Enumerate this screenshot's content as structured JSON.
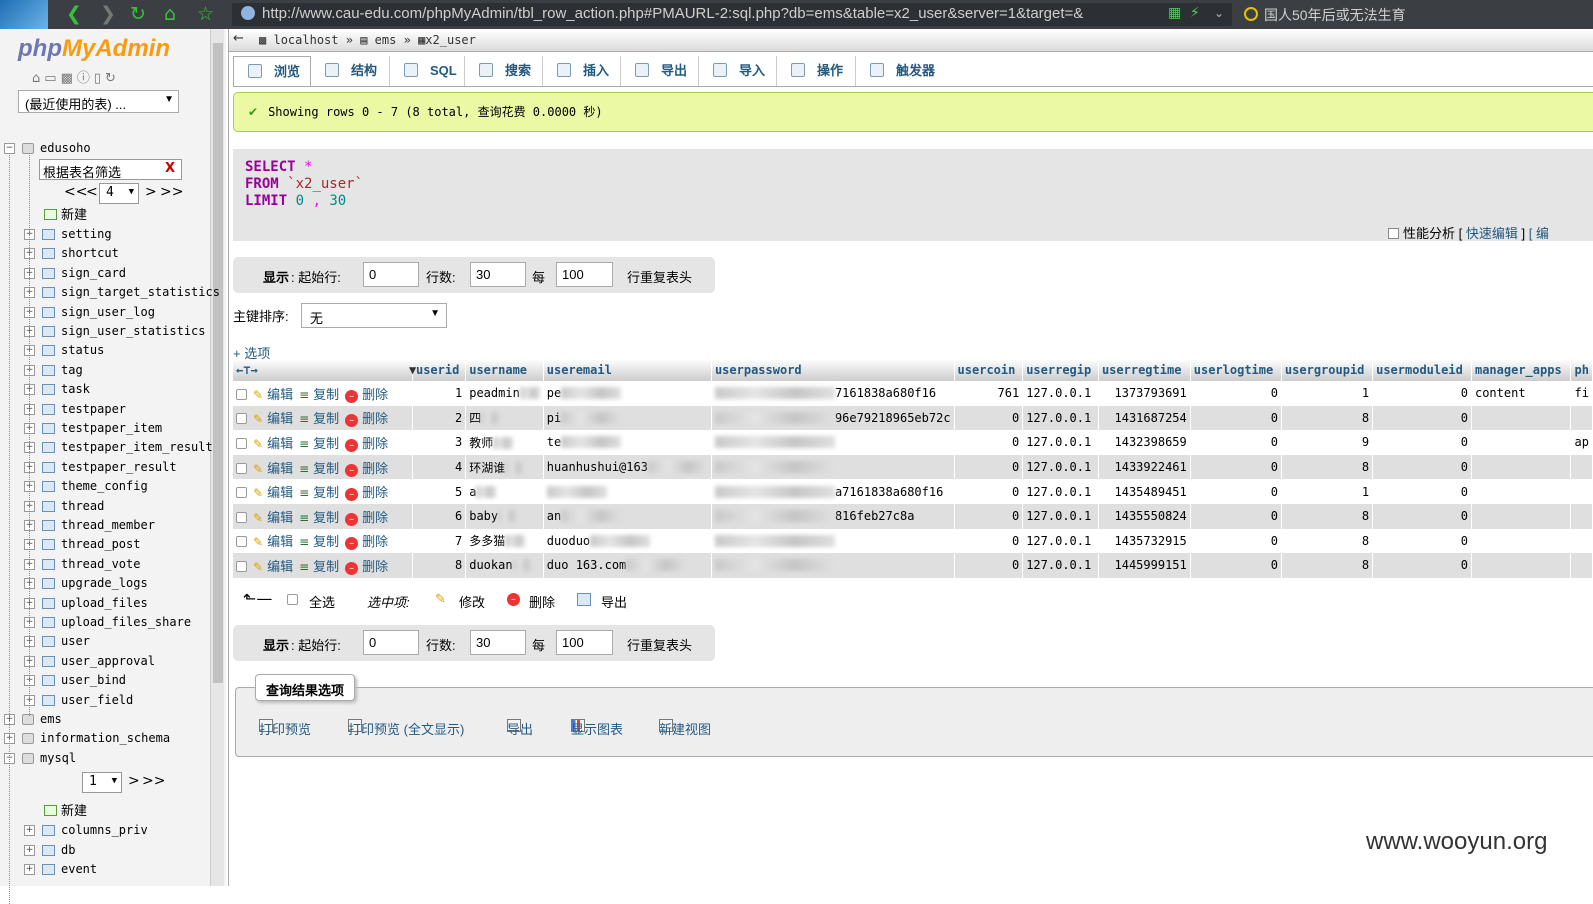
{
  "browser": {
    "url": "http://www.cau-edu.com/phpMyAdmin/tbl_row_action.php#PMAURL-2:sql.php?db=ems&table=x2_user&server=1&target=&",
    "news": "国人50年后或无法生育",
    "icons": [
      "back-icon",
      "forward-icon",
      "refresh-icon",
      "home-icon",
      "star-icon"
    ]
  },
  "sidebar": {
    "logo_php": "php",
    "logo_rest": "MyAdmin",
    "recent": "(最近使用的表) ...",
    "db_edusoho": "edusoho",
    "filter_placeholder": "根据表名筛选",
    "filter_clear": "X",
    "pager1": {
      "first": "<<",
      "prev": "<",
      "value": "4",
      "next": ">",
      "last": ">>"
    },
    "new_label": "新建",
    "tables": [
      "setting",
      "shortcut",
      "sign_card",
      "sign_target_statistics",
      "sign_user_log",
      "sign_user_statistics",
      "status",
      "tag",
      "task",
      "testpaper",
      "testpaper_item",
      "testpaper_item_result",
      "testpaper_result",
      "theme_config",
      "thread",
      "thread_member",
      "thread_post",
      "thread_vote",
      "upgrade_logs",
      "upload_files",
      "upload_files_share",
      "user",
      "user_approval",
      "user_bind",
      "user_field"
    ],
    "dbs": [
      "ems",
      "information_schema",
      "mysql"
    ],
    "pager2": {
      "value": "1",
      "next": ">",
      "last": ">>"
    },
    "new_label2": "新建",
    "mysql_tables": [
      "columns_priv",
      "db",
      "event"
    ]
  },
  "breadcrumb": {
    "server": "localhost",
    "db": "ems",
    "table": "x2_user",
    "sep": "»"
  },
  "tabs": [
    "浏览",
    "结构",
    "SQL",
    "搜索",
    "插入",
    "导出",
    "导入",
    "操作",
    "触发器"
  ],
  "message": "Showing rows 0 - 7 (8 total, 查询花费 0.0000 秒)",
  "sql": {
    "select": "SELECT",
    "star": "*",
    "from": "FROM",
    "table": "`x2_user`",
    "limit": "LIMIT",
    "n1": "0",
    "comma": ",",
    "n2": "30"
  },
  "profiling": {
    "label": "性能分析",
    "bracket_open": "[",
    "quick_edit": "快速编辑",
    "bracket_close": "]",
    "tail": "[ 编"
  },
  "nav": {
    "show": "显示",
    "start_label": ": 起始行:",
    "start": "0",
    "rows_label": "行数:",
    "rows": "30",
    "every": "每",
    "repeat": "100",
    "repeat_label": "行重复表头"
  },
  "sort": {
    "label": "主键排序:",
    "value": "无"
  },
  "options_label": "+ 选项",
  "columns": [
    "userid",
    "username",
    "useremail",
    "userpassword",
    "usercoin",
    "userregip",
    "userregtime",
    "userlogtime",
    "usergroupid",
    "usermoduleid",
    "manager_apps",
    "ph"
  ],
  "actions": {
    "edit": "编辑",
    "copy": "复制",
    "delete": "删除"
  },
  "rows": [
    {
      "userid": "1",
      "username": "peadmin",
      "useremail": "pe",
      "userpassword": "7161838a680f16",
      "usercoin": "761",
      "userregip": "127.0.0.1",
      "userregtime": "1373793691",
      "userlogtime": "0",
      "usergroupid": "1",
      "usermoduleid": "0",
      "manager_apps": "content",
      "ph": "fi"
    },
    {
      "userid": "2",
      "username": "四",
      "useremail": "pi",
      "userpassword": "96e79218965eb72c",
      "usercoin": "0",
      "userregip": "127.0.0.1",
      "userregtime": "1431687254",
      "userlogtime": "0",
      "usergroupid": "8",
      "usermoduleid": "0",
      "manager_apps": "",
      "ph": ""
    },
    {
      "userid": "3",
      "username": "教师",
      "useremail": "te",
      "userpassword": "",
      "usercoin": "0",
      "userregip": "127.0.0.1",
      "userregtime": "1432398659",
      "userlogtime": "0",
      "usergroupid": "9",
      "usermoduleid": "0",
      "manager_apps": "",
      "ph": "ap"
    },
    {
      "userid": "4",
      "username": "环湖谁",
      "useremail": "huanhushui@163",
      "userpassword": "",
      "usercoin": "0",
      "userregip": "127.0.0.1",
      "userregtime": "1433922461",
      "userlogtime": "0",
      "usergroupid": "8",
      "usermoduleid": "0",
      "manager_apps": "",
      "ph": ""
    },
    {
      "userid": "5",
      "username": "a",
      "useremail": "",
      "userpassword": "a7161838a680f16",
      "usercoin": "0",
      "userregip": "127.0.0.1",
      "userregtime": "1435489451",
      "userlogtime": "0",
      "usergroupid": "1",
      "usermoduleid": "0",
      "manager_apps": "",
      "ph": ""
    },
    {
      "userid": "6",
      "username": "baby",
      "useremail": "an",
      "userpassword": "816feb27c8a",
      "usercoin": "0",
      "userregip": "127.0.0.1",
      "userregtime": "1435550824",
      "userlogtime": "0",
      "usergroupid": "8",
      "usermoduleid": "0",
      "manager_apps": "",
      "ph": ""
    },
    {
      "userid": "7",
      "username": "多多猫",
      "useremail": "duoduo",
      "userpassword": "",
      "usercoin": "0",
      "userregip": "127.0.0.1",
      "userregtime": "1435732915",
      "userlogtime": "0",
      "usergroupid": "8",
      "usermoduleid": "0",
      "manager_apps": "",
      "ph": ""
    },
    {
      "userid": "8",
      "username": "duokan",
      "useremail": "duo  163.com",
      "userpassword": "",
      "usercoin": "0",
      "userregip": "127.0.0.1",
      "userregtime": "1445999151",
      "userlogtime": "0",
      "usergroupid": "8",
      "usermoduleid": "0",
      "manager_apps": "",
      "ph": ""
    }
  ],
  "bulk": {
    "select_all": "全选",
    "with_selected": "选中项:",
    "edit": "修改",
    "delete": "删除",
    "export": "导出"
  },
  "query_options": {
    "legend": "查询结果选项",
    "print": "打印预览",
    "print_full": "打印预览 (全文显示)",
    "export": "导出",
    "chart": "显示图表",
    "view": "新建视图"
  },
  "watermark": "www.wooyun.org"
}
